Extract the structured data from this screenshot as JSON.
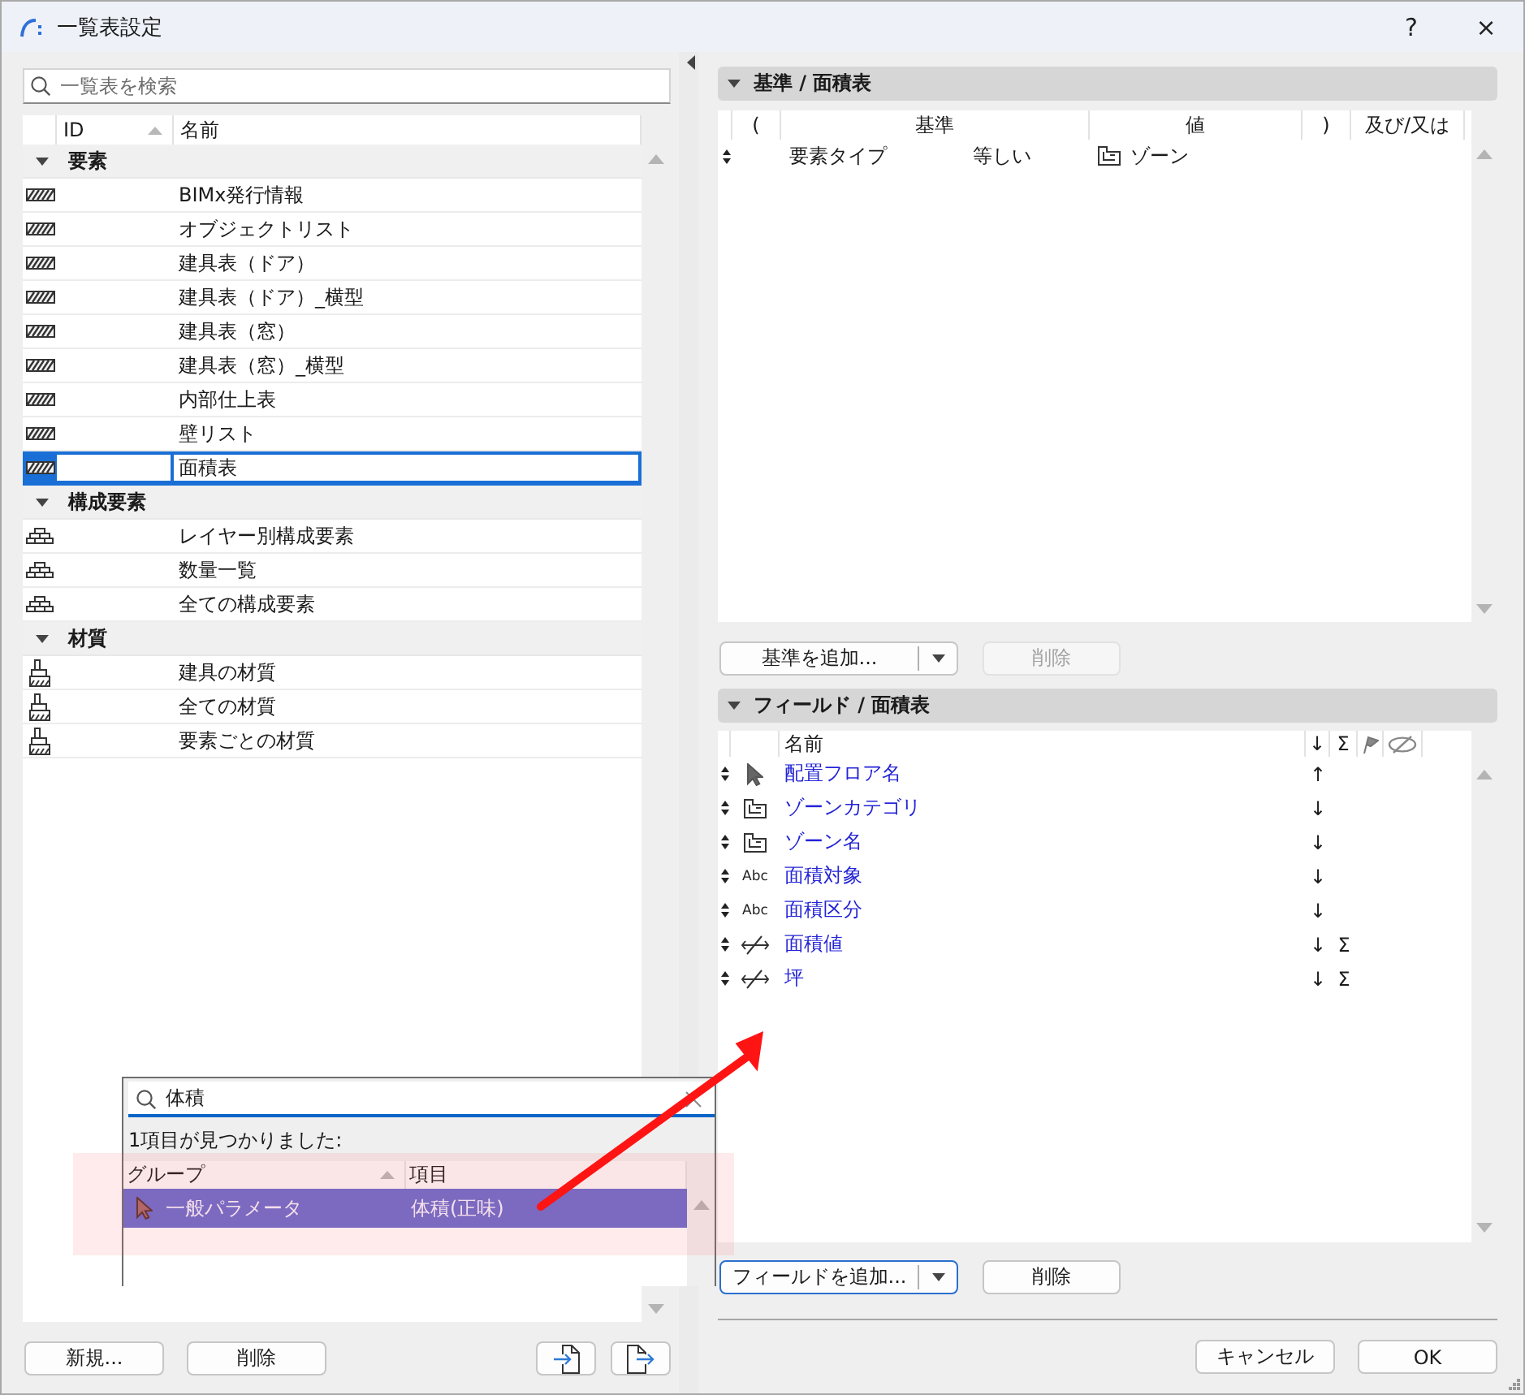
{
  "window": {
    "title": "一覧表設定",
    "help": "?",
    "close": "×"
  },
  "list_panel": {
    "search": {
      "placeholder": "一覧表を検索"
    },
    "columns": [
      {
        "label": "ID",
        "sorted": true
      },
      {
        "label": "名前",
        "sorted": false
      }
    ],
    "groups": [
      {
        "label": "要素",
        "expanded": true,
        "kind": "hatch",
        "items": [
          {
            "name": "BIMx発行情報",
            "selected": false
          },
          {
            "name": "オブジェクトリスト",
            "selected": false
          },
          {
            "name": "建具表（ドア）",
            "selected": false
          },
          {
            "name": "建具表（ドア）_横型",
            "selected": false
          },
          {
            "name": "建具表（窓）",
            "selected": false
          },
          {
            "name": "建具表（窓）_横型",
            "selected": false
          },
          {
            "name": "内部仕上表",
            "selected": false
          },
          {
            "name": "壁リスト",
            "selected": false
          },
          {
            "name": "面積表",
            "selected": true
          }
        ]
      },
      {
        "label": "構成要素",
        "expanded": true,
        "kind": "bricks",
        "items": [
          {
            "name": "レイヤー別構成要素",
            "selected": false
          },
          {
            "name": "数量一覧",
            "selected": false
          },
          {
            "name": "全ての構成要素",
            "selected": false
          }
        ]
      },
      {
        "label": "材質",
        "expanded": true,
        "kind": "brush",
        "items": [
          {
            "name": "建具の材質",
            "selected": false
          },
          {
            "name": "全ての材質",
            "selected": false
          },
          {
            "name": "要素ごとの材質",
            "selected": false
          }
        ]
      }
    ],
    "buttons": [
      "新規...",
      "削除"
    ]
  },
  "criteria": {
    "title": "基準 / 面積表",
    "expanded": true,
    "columns": [
      "(",
      "基準",
      "値",
      ")",
      "及び/又は"
    ],
    "rows": [
      {
        "criterion": "要素タイプ",
        "operator": "等しい",
        "value": "ゾーン"
      }
    ],
    "buttons": [
      {
        "label": "基準を追加...",
        "kind": "split",
        "disabled": false,
        "focused": false
      },
      {
        "label": "削除",
        "kind": "plain",
        "disabled": true,
        "focused": false
      }
    ]
  },
  "fields": {
    "title": "フィールド / 面積表",
    "expanded": true,
    "columns": [
      {
        "kind": "text",
        "label": "名前"
      },
      {
        "kind": "text",
        "label": "↓"
      },
      {
        "kind": "text",
        "label": "Σ"
      },
      {
        "kind": "flag"
      },
      {
        "kind": "hidden"
      }
    ],
    "rows": [
      {
        "kind": "pointer",
        "name": "配置フロア名",
        "sort": "↑"
      },
      {
        "kind": "zone",
        "name": "ゾーンカテゴリ",
        "sort": "↓"
      },
      {
        "kind": "zone",
        "name": "ゾーン名",
        "sort": "↓"
      },
      {
        "kind": "text",
        "icon_text": "Abc",
        "name": "面積対象",
        "sort": "↓"
      },
      {
        "kind": "text",
        "icon_text": "Abc",
        "name": "面積区分",
        "sort": "↓"
      },
      {
        "kind": "measure",
        "name": "面積値",
        "sort": "↓",
        "total": "Σ"
      },
      {
        "kind": "measure",
        "name": "坪",
        "sort": "↓",
        "total": "Σ"
      }
    ],
    "buttons": [
      {
        "label": "フィールドを追加...",
        "kind": "split",
        "disabled": false,
        "focused": true
      },
      {
        "label": "削除",
        "kind": "plain",
        "disabled": false,
        "focused": false
      }
    ]
  },
  "search_popup": {
    "search": {
      "value": "体積"
    },
    "result": "1項目が見つかりました:",
    "columns": [
      {
        "label": "グループ",
        "sorted": true
      },
      {
        "label": "項目",
        "sorted": false
      }
    ],
    "rows": [
      {
        "group": "一般パラメータ",
        "item": "体積(正味)",
        "selected": true
      }
    ]
  },
  "footer": {
    "buttons": [
      "キャンセル",
      "OK"
    ]
  }
}
